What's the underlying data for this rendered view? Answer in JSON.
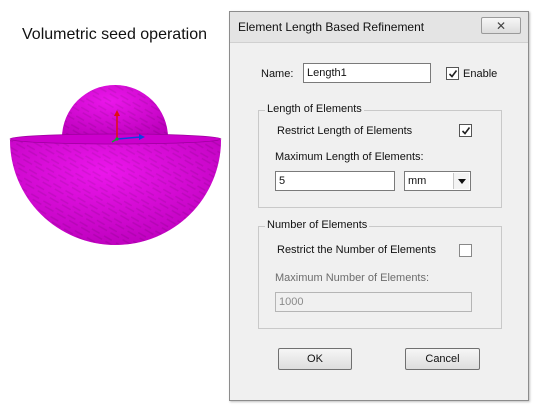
{
  "caption": "Volumetric seed operation",
  "dialog": {
    "title": "Element Length Based Refinement",
    "close_glyph": "✕",
    "name_label": "Name:",
    "name_value": "Length1",
    "enable_label": "Enable",
    "enable_checked": true,
    "length_group": {
      "legend": "Length of Elements",
      "restrict_label": "Restrict Length of Elements",
      "restrict_checked": true,
      "max_label": "Maximum Length of Elements:",
      "max_value": "5",
      "unit_selected": "mm"
    },
    "number_group": {
      "legend": "Number of Elements",
      "restrict_label": "Restrict the Number of Elements",
      "restrict_checked": false,
      "max_label": "Maximum Number of  Elements:",
      "max_value": "1000"
    },
    "ok_label": "OK",
    "cancel_label": "Cancel"
  },
  "colors": {
    "mesh": "#e000e0",
    "axis_y": "#e01010",
    "axis_x": "#1040e0",
    "axis_z": "#10a030"
  }
}
